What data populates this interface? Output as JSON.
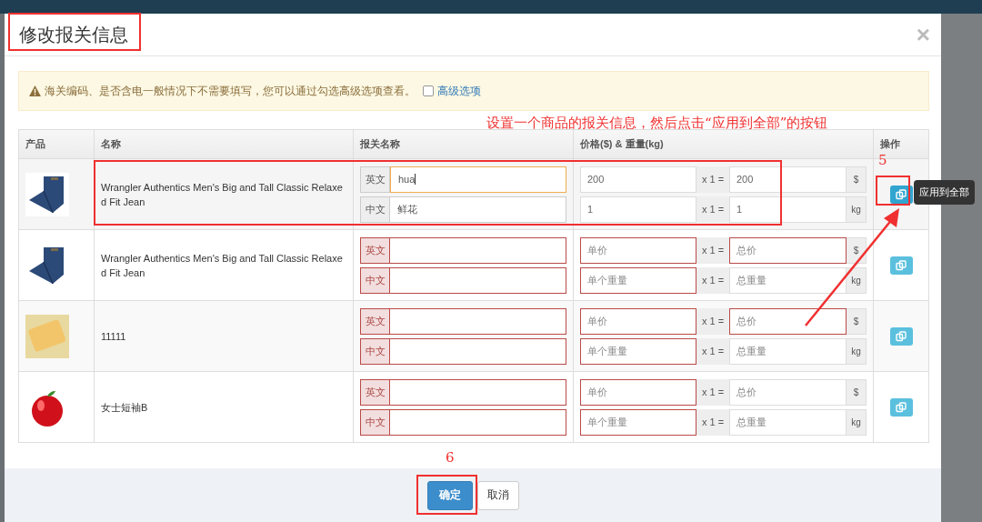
{
  "modal": {
    "title": "修改报关信息",
    "close": "×",
    "alert": {
      "text": "海关编码、是否含电一般情况下不需要填写，您可以通过勾选高级选项查看。",
      "option_label": "高级选项",
      "option_checked": false
    },
    "table": {
      "columns": [
        "产品",
        "名称",
        "报关名称",
        "价格($) & 重量(kg)",
        "操作"
      ],
      "tooltip": "应用到全部",
      "rows": [
        {
          "kind": "jeans",
          "name": "Wrangler Authentics Men's Big and Tall Classic Relaxed Fit Jean",
          "hovered": true,
          "customs": [
            {
              "label": "英文",
              "value": "hua",
              "focused": true,
              "invalid": false
            },
            {
              "label": "中文",
              "value": "鲜花",
              "focused": false,
              "invalid": false
            }
          ],
          "lines": [
            {
              "unit": {
                "value": "200",
                "invalid": false
              },
              "multiplier": "x 1 =",
              "total": {
                "value": "200",
                "invalid": false
              },
              "suffix": "$"
            },
            {
              "unit": {
                "value": "1",
                "invalid": false
              },
              "multiplier": "x 1 =",
              "total": {
                "value": "1",
                "invalid": false
              },
              "suffix": "kg"
            }
          ]
        },
        {
          "kind": "jeans",
          "name": "Wrangler Authentics Men's Big and Tall Classic Relaxed Fit Jean",
          "hovered": false,
          "customs": [
            {
              "label": "英文",
              "focused": false,
              "invalid": true
            },
            {
              "label": "中文",
              "focused": false,
              "invalid": true
            }
          ],
          "lines": [
            {
              "unit": {
                "placeholder": "单价",
                "invalid": true
              },
              "multiplier": "x 1 =",
              "total": {
                "placeholder": "总价",
                "invalid": true
              },
              "suffix": "$"
            },
            {
              "unit": {
                "placeholder": "单个重量",
                "invalid": true
              },
              "multiplier": "x 1 =",
              "total": {
                "placeholder": "总重量",
                "invalid": false
              },
              "suffix": "kg"
            }
          ]
        },
        {
          "kind": "phone",
          "name": "11111",
          "hovered": false,
          "customs": [
            {
              "label": "英文",
              "focused": false,
              "invalid": true
            },
            {
              "label": "中文",
              "focused": false,
              "invalid": true
            }
          ],
          "lines": [
            {
              "unit": {
                "placeholder": "单价",
                "invalid": true
              },
              "multiplier": "x 1 =",
              "total": {
                "placeholder": "总价",
                "invalid": true
              },
              "suffix": "$"
            },
            {
              "unit": {
                "placeholder": "单个重量",
                "invalid": true
              },
              "multiplier": "x 1 =",
              "total": {
                "placeholder": "总重量",
                "invalid": false
              },
              "suffix": "kg"
            }
          ]
        },
        {
          "kind": "apple",
          "name": "女士短袖B",
          "hovered": false,
          "customs": [
            {
              "label": "英文",
              "focused": false,
              "invalid": true
            },
            {
              "label": "中文",
              "focused": false,
              "invalid": true
            }
          ],
          "lines": [
            {
              "unit": {
                "placeholder": "单价",
                "invalid": true
              },
              "multiplier": "x 1 =",
              "total": {
                "placeholder": "总价",
                "invalid": false
              },
              "suffix": "$"
            },
            {
              "unit": {
                "placeholder": "单个重量",
                "invalid": true
              },
              "multiplier": "x 1 =",
              "total": {
                "placeholder": "总重量",
                "invalid": false
              },
              "suffix": "kg"
            }
          ]
        }
      ]
    },
    "buttons": [
      {
        "label": "确定",
        "kind": "primary"
      },
      {
        "label": "取消",
        "kind": "default"
      }
    ]
  },
  "annotations": {
    "instruction": "设置一个商品的报关信息，然后点击“应用到全部”的按钮",
    "steps": [
      "5",
      "6"
    ]
  }
}
